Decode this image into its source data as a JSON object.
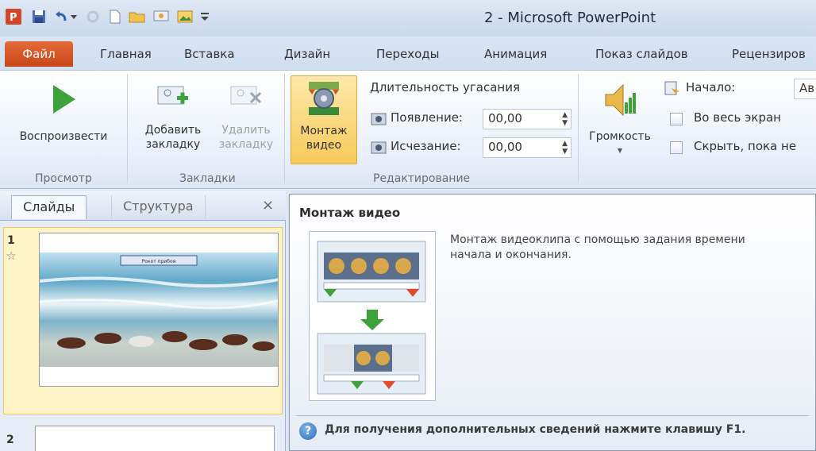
{
  "window": {
    "title": "2 - Microsoft PowerPoint"
  },
  "quick_access": [
    {
      "icon": "powerpoint-logo-icon"
    },
    {
      "icon": "save-icon"
    },
    {
      "icon": "undo-icon"
    },
    {
      "icon": "redo-icon"
    },
    {
      "icon": "new-file-icon"
    },
    {
      "icon": "open-folder-icon"
    },
    {
      "icon": "slideshow-icon"
    },
    {
      "icon": "picture-icon"
    },
    {
      "icon": "customize-dropdown-icon"
    }
  ],
  "tabs": {
    "file": "Файл",
    "home": "Главная",
    "insert": "Вставка",
    "design": "Дизайн",
    "transitions": "Переходы",
    "animations": "Анимация",
    "slideshow": "Показ слайдов",
    "review": "Рецензиров"
  },
  "ribbon": {
    "preview": {
      "play_label": "Воспроизвести",
      "group_label": "Просмотр"
    },
    "bookmarks": {
      "add_line1": "Добавить",
      "add_line2": "закладку",
      "remove_line1": "Удалить",
      "remove_line2": "закладку",
      "group_label": "Закладки"
    },
    "editing": {
      "trim_line1": "Монтаж",
      "trim_line2": "видео",
      "fade_title": "Длительность угасания",
      "fade_in_label": "Появление:",
      "fade_in_value": "00,00",
      "fade_out_label": "Исчезание:",
      "fade_out_value": "00,00",
      "group_label": "Редактирование"
    },
    "options": {
      "volume_label": "Громкость",
      "start_label": "Начало:",
      "start_value": "Ав",
      "fullscreen_label": "Во весь экран",
      "hide_label": "Скрыть, пока не"
    }
  },
  "slides_pane": {
    "tab_slides": "Слайды",
    "tab_structure": "Структура",
    "close": "×",
    "slide1_num": "1",
    "slide1_caption": "Рокот прибоя",
    "slide2_num": "2"
  },
  "tooltip": {
    "title": "Монтаж видео",
    "description": "Монтаж видеоклипа с помощью задания времени начала и окончания.",
    "help": "Для получения дополнительных сведений нажмите клавишу F1."
  }
}
